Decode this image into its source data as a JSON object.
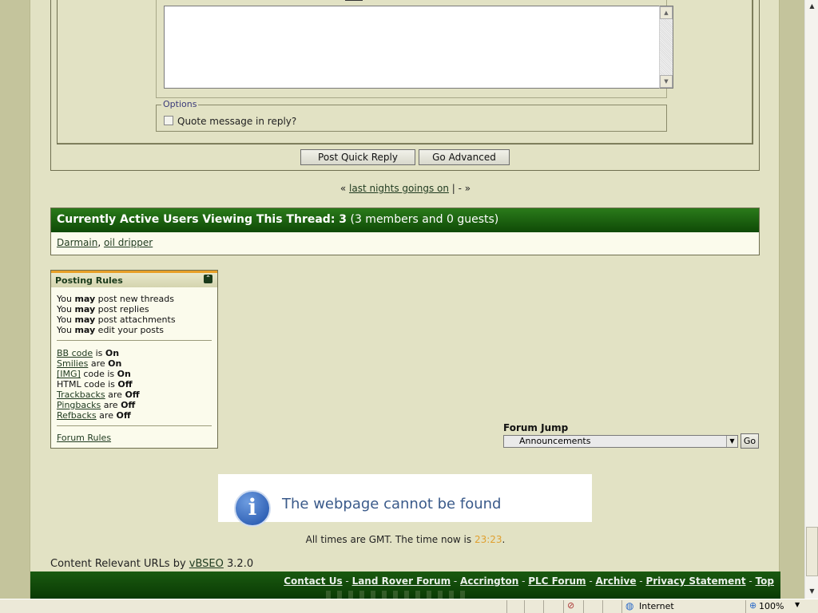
{
  "quick_reply": {
    "options_legend": "Options",
    "quote_label": "Quote message in reply?",
    "post_button": "Post Quick Reply",
    "advanced_button": "Go Advanced"
  },
  "thread_nav": {
    "prev_symbol": "«",
    "prev_link": "last nights goings on",
    "separator": " | - ",
    "next_symbol": "»"
  },
  "active_users": {
    "title": "Currently Active Users Viewing This Thread: 3",
    "detail": "(3 members and 0 guests)",
    "users": [
      "Darmain",
      "oil dripper"
    ]
  },
  "posting_rules": {
    "title": "Posting Rules",
    "permissions": [
      {
        "pre": "You ",
        "bold": "may",
        "post": " post new threads"
      },
      {
        "pre": "You ",
        "bold": "may",
        "post": " post replies"
      },
      {
        "pre": "You ",
        "bold": "may",
        "post": " post attachments"
      },
      {
        "pre": "You ",
        "bold": "may",
        "post": " edit your posts"
      }
    ],
    "settings": [
      {
        "link": "BB code",
        "text": " is ",
        "value": "On"
      },
      {
        "link": "Smilies",
        "text": " are ",
        "value": "On"
      },
      {
        "link": "[IMG]",
        "text": " code is ",
        "value": "On"
      },
      {
        "link": "",
        "text": "HTML code is ",
        "value": "Off"
      },
      {
        "link": "Trackbacks",
        "text": " are ",
        "value": "Off"
      },
      {
        "link": "Pingbacks",
        "text": " are ",
        "value": "Off"
      },
      {
        "link": "Refbacks",
        "text": " are ",
        "value": "Off"
      }
    ],
    "forum_rules": "Forum Rules"
  },
  "forum_jump": {
    "label": "Forum Jump",
    "selected": "Announcements",
    "go": "Go"
  },
  "error": {
    "message": "The webpage cannot be found"
  },
  "time": {
    "prefix": "All times are GMT. The time now is ",
    "value": "23:23",
    "suffix": "."
  },
  "vbseo": {
    "prefix": "Content Relevant URLs by ",
    "link": "vBSEO",
    "version": " 3.2.0"
  },
  "footer_links": [
    "Contact Us",
    "Land Rover Forum",
    "Accrington",
    "PLC Forum",
    "Archive",
    "Privacy Statement",
    "Top"
  ],
  "status_bar": {
    "zone": "Internet",
    "zoom": "100%"
  },
  "colors": {
    "header_green": "#0f4a06",
    "page_bg": "#e2e2c4",
    "accent_orange": "#e8a028"
  }
}
